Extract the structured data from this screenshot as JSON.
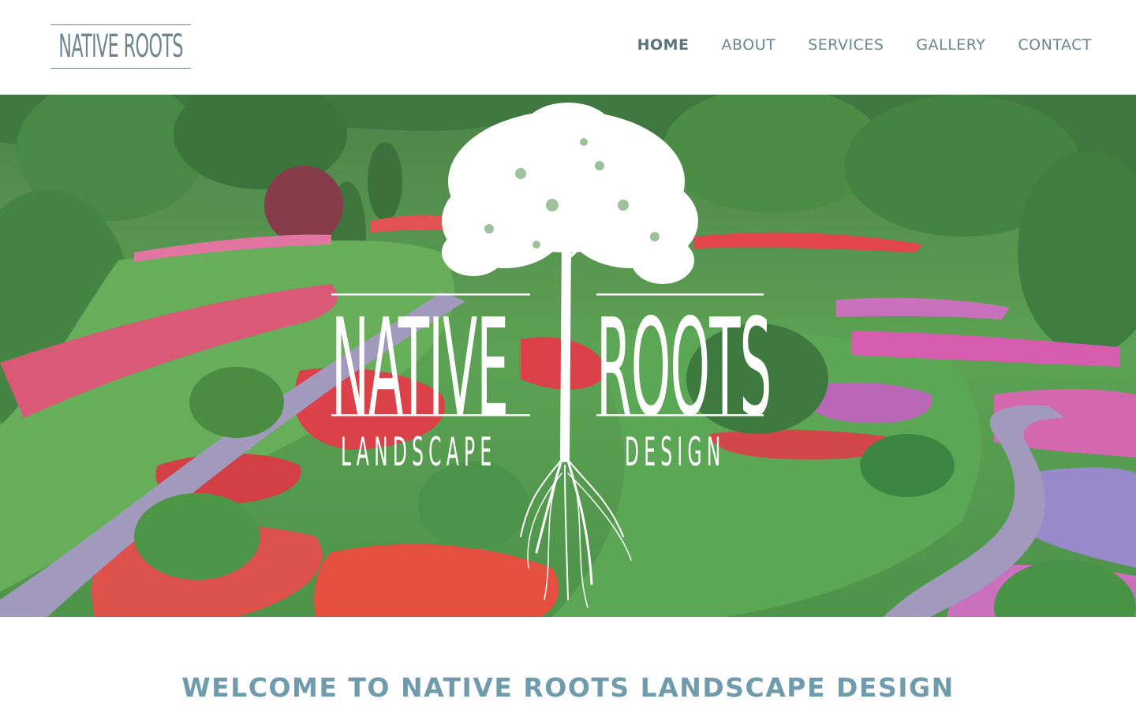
{
  "header": {
    "logo_text": "NATIVE ROOTS",
    "nav": [
      {
        "label": "HOME",
        "active": true
      },
      {
        "label": "ABOUT",
        "active": false
      },
      {
        "label": "SERVICES",
        "active": false
      },
      {
        "label": "GALLERY",
        "active": false
      },
      {
        "label": "CONTACT",
        "active": false
      }
    ]
  },
  "hero": {
    "word_left": "NATIVE",
    "word_right": "ROOTS",
    "sub_left": "LANDSCAPE",
    "sub_right": "DESIGN",
    "icon": "tree-with-roots-icon"
  },
  "welcome": {
    "heading": "WELCOME TO NATIVE ROOTS LANDSCAPE DESIGN"
  },
  "colors": {
    "brand": "#6e8591",
    "heading": "#6f9bad",
    "garden_green": "#4e8f47",
    "flower_red": "#d8313a",
    "flower_pink": "#c45aa6",
    "path_lavender": "#9a92b8"
  }
}
